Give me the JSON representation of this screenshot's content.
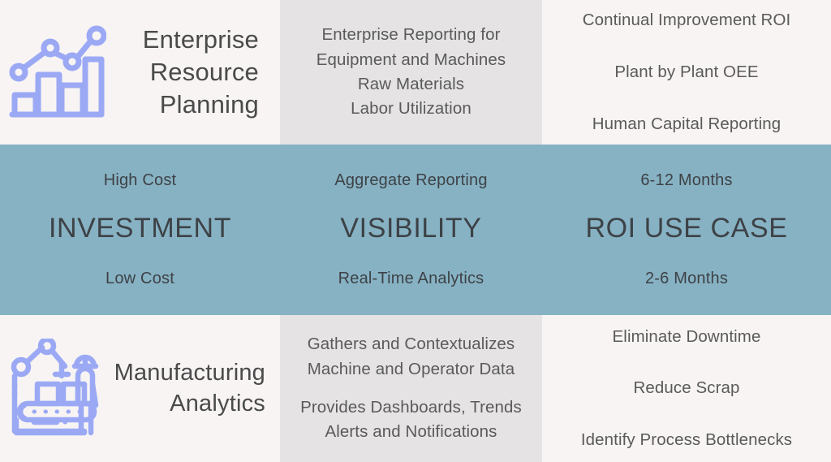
{
  "colors": {
    "background_light": "#F7F4F3",
    "background_grey": "#E5E3E4",
    "band_blue": "#87B2C4",
    "icon_periwinkle": "#9BA9F5",
    "heading_text": "#4a4a4a",
    "body_text": "#5a5a5a",
    "band_text": "#3d4246"
  },
  "rows": {
    "top": {
      "title": "Enterprise\nResource\nPlanning",
      "icon": "bar-chart-line-graph-icon",
      "features": [
        "Enterprise Reporting for",
        "Equipment and Machines",
        "Raw Materials",
        "Labor Utilization"
      ],
      "outcomes": [
        "Continual Improvement ROI",
        "Plant by Plant OEE",
        "Human Capital Reporting"
      ]
    },
    "band": {
      "columns": [
        {
          "top": "High Cost",
          "main": "INVESTMENT",
          "bottom": "Low Cost"
        },
        {
          "top": "Aggregate Reporting",
          "main": "VISIBILITY",
          "bottom": "Real-Time Analytics"
        },
        {
          "top": "6-12 Months",
          "main": "ROI USE CASE",
          "bottom": "2-6 Months"
        }
      ]
    },
    "bottom": {
      "title": "Manufacturing\nAnalytics",
      "icon": "factory-robot-conveyor-worker-icon",
      "features_group_1": [
        "Gathers and Contextualizes",
        "Machine and Operator Data"
      ],
      "features_group_2": [
        "Provides Dashboards, Trends",
        "Alerts and Notifications"
      ],
      "outcomes": [
        "Eliminate Downtime",
        "Reduce Scrap",
        "Identify Process Bottlenecks"
      ]
    }
  }
}
